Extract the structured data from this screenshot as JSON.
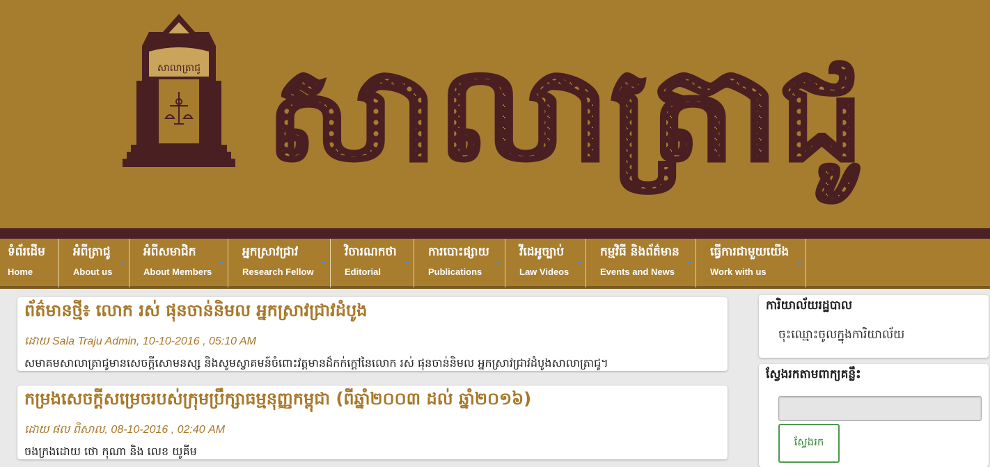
{
  "banner": {
    "logo_emblem_text": "សាលាត្រាជូ",
    "site_title": "សាលាត្រាជូ",
    "colors": {
      "background": "#a67c2f",
      "ink": "#4a1f22",
      "accent": "#c9a45a"
    }
  },
  "nav": {
    "items": [
      {
        "km": "ទំព័រដើម",
        "en": "Home",
        "has_dropdown": false
      },
      {
        "km": "អំពីត្រាជូ",
        "en": "About us",
        "has_dropdown": true
      },
      {
        "km": "អំពីសមាជិក",
        "en": "About Members",
        "has_dropdown": true
      },
      {
        "km": "អ្នកស្រាវជ្រាវ",
        "en": "Research Fellow",
        "has_dropdown": true
      },
      {
        "km": "វិចារណកថា",
        "en": "Editorial",
        "has_dropdown": true
      },
      {
        "km": "ការបោះផ្សាយ",
        "en": "Publications",
        "has_dropdown": true
      },
      {
        "km": "វីដេអូច្បាប់",
        "en": "Law Videos",
        "has_dropdown": true
      },
      {
        "km": "កម្មវិធី និងព័ត៌មាន",
        "en": "Events and News",
        "has_dropdown": true
      },
      {
        "km": "ធ្វើការជាមួយយើង",
        "en": "Work with us",
        "has_dropdown": true
      }
    ]
  },
  "posts": [
    {
      "title": "ព័ត៌មានថ្មី៖ លោក រស់ ផុនចាន់និមល អ្នកស្រាវជ្រាវដំបូង",
      "meta": "ដោយ Sala Traju Admin, 10-10-2016 , 05:10 AM",
      "excerpt": "សមាគមសាលាត្រាជូមានសេចក្តីសោមនស្ស និងសូមស្វាគមន៍ចំពោះវត្តមានដ៏កក់ក្តៅនៃលោក រស់ ផុនចាន់និមល អ្នកស្រាវជ្រាវដំបូងសាលាត្រាជូ។"
    },
    {
      "title": "កម្រងសេចក្តីសម្រេចរបស់ក្រុមប្រឹក្សាធម្មនុញ្ញកម្ពុជា (ពីឆ្នាំ២០០៣ ដល់ ឆ្នាំ២០១៦)",
      "meta": "ដោយ ផល ពិសាល, 08-10-2016 , 02:40 AM",
      "excerpt": "ចងក្រងដោយ ថោ កុណា និង លេខ យូគីម"
    }
  ],
  "sidebar": {
    "admin_widget": {
      "title": "ការិយាល័យរដ្ឋបាល",
      "link": "ចុះឈ្មោះចូលក្នុងការិយាល័យ"
    },
    "search_widget": {
      "title": "ស្វែងរកតាមពាក្យគន្លឹះ",
      "input_value": "",
      "button_label": "ស្វែងរក"
    }
  }
}
